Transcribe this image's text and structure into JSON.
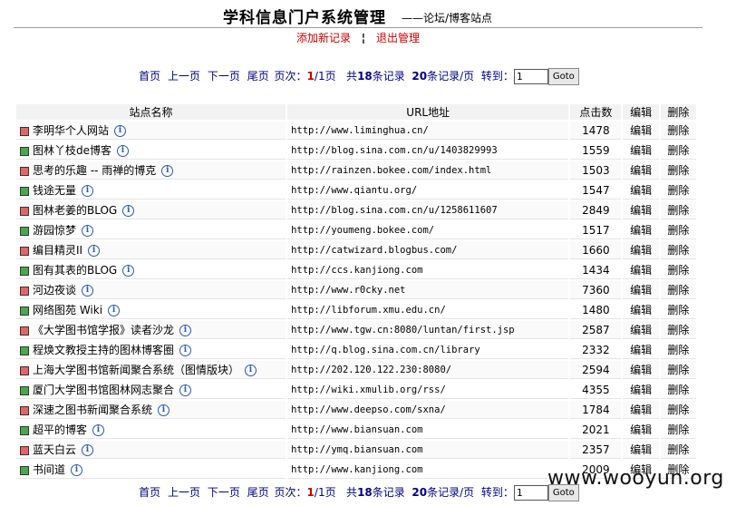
{
  "header": {
    "title": "学科信息门户系统管理",
    "subtitle": "——论坛/博客站点",
    "add_link": "添加新记录",
    "separator": "¦",
    "logout_link": "退出管理"
  },
  "pager": {
    "first": "首页",
    "prev": "上一页",
    "next": "下一页",
    "last": "尾页",
    "page_label": "页次：",
    "current_page": "1",
    "total_pages": "/1页",
    "total_prefix": "共",
    "total_records": "18",
    "total_suffix": "条记录",
    "per_page": "20",
    "per_page_suffix": "条记录/页",
    "goto_label": "转到：",
    "goto_value": "1",
    "goto_button": "Goto"
  },
  "table": {
    "columns": [
      "站点名称",
      "URL地址",
      "点击数",
      "编辑",
      "删除"
    ],
    "edit_label": "编辑",
    "delete_label": "删除",
    "rows": [
      {
        "color": "#e06666",
        "name": "李明华个人网站",
        "url": "http://www.liminghua.cn/",
        "clicks": "1478"
      },
      {
        "color": "#4aa84a",
        "name": "图林丫枝de博客",
        "url": "http://blog.sina.com.cn/u/1403829993",
        "clicks": "1559"
      },
      {
        "color": "#e06666",
        "name": "思考的乐趣 -- 雨禅的博克",
        "url": "http://rainzen.bokee.com/index.html",
        "clicks": "1503"
      },
      {
        "color": "#4aa84a",
        "name": "钱途无量",
        "url": "http://www.qiantu.org/",
        "clicks": "1547"
      },
      {
        "color": "#e06666",
        "name": "图林老姜的BLOG",
        "url": "http://blog.sina.com.cn/u/1258611607",
        "clicks": "2849"
      },
      {
        "color": "#4aa84a",
        "name": "游园惊梦",
        "url": "http://youmeng.bokee.com/",
        "clicks": "1517"
      },
      {
        "color": "#e06666",
        "name": "编目精灵II",
        "url": "http://catwizard.blogbus.com/",
        "clicks": "1660"
      },
      {
        "color": "#4aa84a",
        "name": "图有其表的BLOG",
        "url": "http://ccs.kanjiong.com",
        "clicks": "1434"
      },
      {
        "color": "#e06666",
        "name": "河边夜谈",
        "url": "http://www.r0cky.net",
        "clicks": "7360"
      },
      {
        "color": "#4aa84a",
        "name": "网络图苑 Wiki",
        "url": "http://libforum.xmu.edu.cn/",
        "clicks": "1480"
      },
      {
        "color": "#e06666",
        "name": "《大学图书馆学报》读者沙龙",
        "url": "http://www.tgw.cn:8080/luntan/first.jsp",
        "clicks": "2587"
      },
      {
        "color": "#4aa84a",
        "name": "程焕文教授主持的图林博客圈",
        "url": "http://q.blog.sina.com.cn/library",
        "clicks": "2332"
      },
      {
        "color": "#e06666",
        "name": "上海大学图书馆新闻聚合系统（图情版块）",
        "url": "http://202.120.122.230:8080/",
        "clicks": "2594"
      },
      {
        "color": "#4aa84a",
        "name": "厦门大学图书馆图林网志聚合",
        "url": "http://wiki.xmulib.org/rss/",
        "clicks": "4355"
      },
      {
        "color": "#e06666",
        "name": "深速之图书新闻聚合系统",
        "url": "http://www.deepso.com/sxna/",
        "clicks": "1784"
      },
      {
        "color": "#4aa84a",
        "name": "超平的博客",
        "url": "http://www.biansuan.com",
        "clicks": "2021"
      },
      {
        "color": "#e06666",
        "name": "蓝天白云",
        "url": "http://ymq.biansuan.com",
        "clicks": "2357"
      },
      {
        "color": "#4aa84a",
        "name": "书间道",
        "url": "http://www.kanjiong.com",
        "clicks": "2009"
      }
    ]
  },
  "watermark": "www.wooyun.org"
}
